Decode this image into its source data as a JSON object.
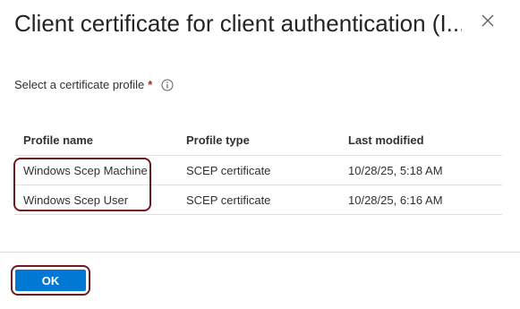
{
  "dialog": {
    "title": "Client certificate for client authentication (I...",
    "close_icon": "close-icon"
  },
  "field": {
    "label": "Select a certificate profile",
    "required_mark": "*",
    "info_icon": "info-icon"
  },
  "table": {
    "columns": [
      "Profile name",
      "Profile type",
      "Last modified"
    ],
    "rows": [
      {
        "name": "Windows Scep Machine",
        "type": "SCEP certificate",
        "modified": "10/28/25, 5:18 AM"
      },
      {
        "name": "Windows Scep User",
        "type": "SCEP certificate",
        "modified": "10/28/25, 6:16 AM"
      }
    ]
  },
  "footer": {
    "ok_label": "OK"
  },
  "colors": {
    "accent": "#0078d4",
    "highlight": "#6e1b20",
    "required": "#a4262c"
  }
}
